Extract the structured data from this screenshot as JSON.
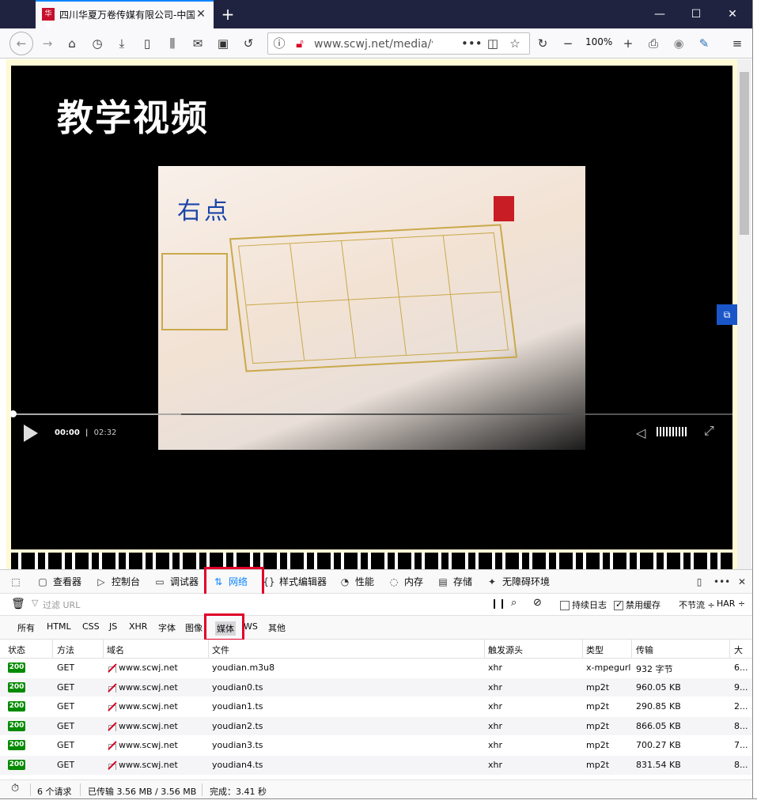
{
  "tab": {
    "title": "四川华夏万卷传媒有限公司-中国",
    "favicon": "华夏"
  },
  "window": {
    "minimize": "—",
    "maximize": "☐",
    "close": "✕",
    "new_tab": "+"
  },
  "nav": {
    "url": "www.scwj.net/media/vi",
    "zoom": "100%",
    "more": "•••"
  },
  "video": {
    "title": "教学视频",
    "frame_label": "右点",
    "current_time": "00:00",
    "separator": "|",
    "duration": "02:32"
  },
  "devtools": {
    "tabs": [
      "查看器",
      "控制台",
      "调试器",
      "网络",
      "样式编辑器",
      "性能",
      "内存",
      "存储",
      "无障碍环境"
    ],
    "filter_placeholder": "过滤 URL",
    "persist_logs": "持续日志",
    "disable_cache": "禁用缓存",
    "throttle": "不节流 ÷",
    "har": "HAR ÷",
    "types": [
      "所有",
      "HTML",
      "CSS",
      "JS",
      "XHR",
      "字体",
      "图像",
      "媒体",
      "WS",
      "其他"
    ],
    "columns": [
      "状态",
      "方法",
      "域名",
      "文件",
      "触发源头",
      "类型",
      "传输",
      "大"
    ],
    "requests": [
      {
        "status": "200",
        "method": "GET",
        "domain": "www.scwj.net",
        "file": "youdian.m3u8",
        "cause": "xhr",
        "type": "x-mpegurl",
        "transferred": "932 字节",
        "size": "6..."
      },
      {
        "status": "200",
        "method": "GET",
        "domain": "www.scwj.net",
        "file": "youdian0.ts",
        "cause": "xhr",
        "type": "mp2t",
        "transferred": "960.05 KB",
        "size": "9..."
      },
      {
        "status": "200",
        "method": "GET",
        "domain": "www.scwj.net",
        "file": "youdian1.ts",
        "cause": "xhr",
        "type": "mp2t",
        "transferred": "290.85 KB",
        "size": "2..."
      },
      {
        "status": "200",
        "method": "GET",
        "domain": "www.scwj.net",
        "file": "youdian2.ts",
        "cause": "xhr",
        "type": "mp2t",
        "transferred": "866.05 KB",
        "size": "8..."
      },
      {
        "status": "200",
        "method": "GET",
        "domain": "www.scwj.net",
        "file": "youdian3.ts",
        "cause": "xhr",
        "type": "mp2t",
        "transferred": "700.27 KB",
        "size": "7..."
      },
      {
        "status": "200",
        "method": "GET",
        "domain": "www.scwj.net",
        "file": "youdian4.ts",
        "cause": "xhr",
        "type": "mp2t",
        "transferred": "831.54 KB",
        "size": "8..."
      }
    ],
    "summary": {
      "requests": "6 个请求",
      "transferred": "已传输 3.56 MB / 3.56 MB",
      "finish": "完成：3.41 秒"
    }
  },
  "colors": {
    "active_tab": "#0a84ff",
    "highlight": "#e0002a",
    "status_ok": "#058b00",
    "titlebar": "#202340"
  }
}
